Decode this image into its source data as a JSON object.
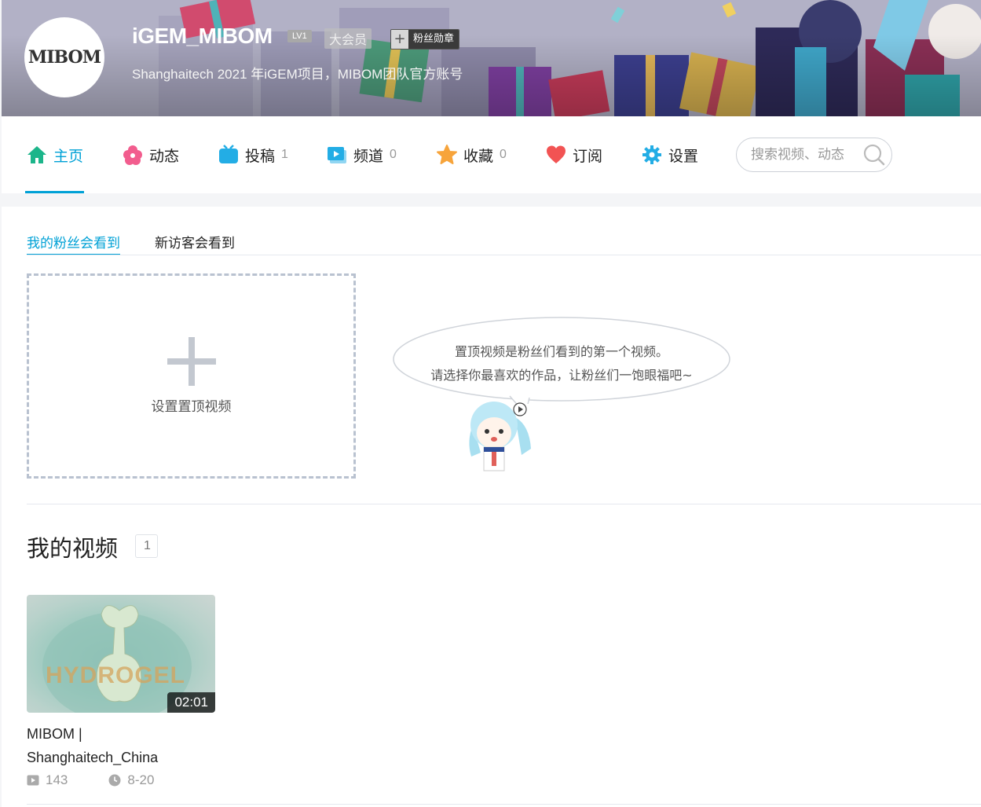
{
  "banner": {
    "username": "iGEM_MIBOM",
    "level": "LV1",
    "vip": "大会员",
    "medal_plus": "+",
    "medal": "粉丝勋章",
    "signature": "Shanghaitech 2021 年iGEM项目，MIBOM团队官方账号",
    "avatar_logo": "MIBOM"
  },
  "nav": {
    "items": [
      {
        "label": "主页",
        "icon": "home-icon",
        "count": ""
      },
      {
        "label": "动态",
        "icon": "flower-icon",
        "count": ""
      },
      {
        "label": "投稿",
        "icon": "tv-icon",
        "count": "1"
      },
      {
        "label": "频道",
        "icon": "channel-icon",
        "count": "0"
      },
      {
        "label": "收藏",
        "icon": "star-icon",
        "count": "0"
      },
      {
        "label": "订阅",
        "icon": "heart-icon",
        "count": ""
      },
      {
        "label": "设置",
        "icon": "gear-icon",
        "count": ""
      }
    ],
    "search_placeholder": "搜索视频、动态"
  },
  "tabs": [
    "我的粉丝会看到",
    "新访客会看到"
  ],
  "pin": {
    "label": "设置置顶视频",
    "tip_line1": "置顶视频是粉丝们看到的第一个视频。",
    "tip_line2": "请选择你最喜欢的作品，让粉丝们一饱眼福吧~"
  },
  "videos_section": {
    "title": "我的视频",
    "count": "1",
    "items": [
      {
        "thumb_text": "HYDROGEL",
        "duration": "02:01",
        "title_line1": "MIBOM |",
        "title_line2": "Shanghaitech_China",
        "plays": "143",
        "date": "8-20"
      }
    ]
  },
  "colors": {
    "accent": "#00a1d6",
    "home": "#1cb58a",
    "pink": "#f25d8e",
    "blue": "#23ade5",
    "orange": "#f7a43b",
    "red": "#f25353"
  }
}
